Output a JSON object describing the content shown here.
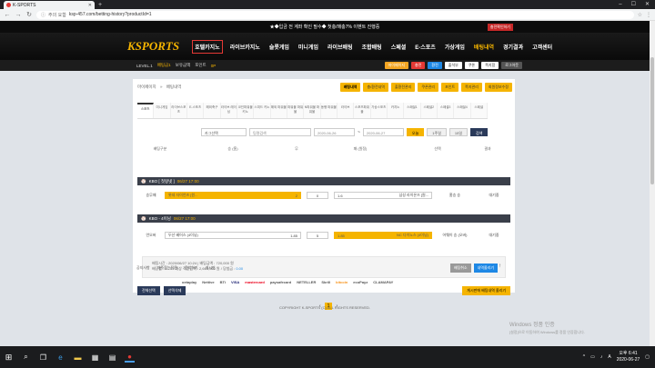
{
  "browser": {
    "tab_title": "K-SPORTS",
    "url_warning": "주의 요함",
    "url": "ksp-457.com/betting-history?productId=1"
  },
  "site": {
    "notice": "★◆입금 전 계좌 확인 필수◆ 첫충/매충7% 이벤트 진행중",
    "notice_badge": "충전확인하기",
    "logo": "SPORTS",
    "logo_badge": "K",
    "nav": [
      "호텔카지노",
      "라이브카지노",
      "슬롯게임",
      "미니게임",
      "라이브배팅",
      "조합배팅",
      "스페셜",
      "E-스포츠",
      "가상게임",
      "배팅내역",
      "경기결과",
      "고객센터"
    ],
    "user": {
      "level": "LEVEL.1",
      "nickname": "배팅금1",
      "balance_label": "보유금액",
      "points_label": "포인트",
      "points_value": "0P",
      "buttons": [
        "마이페이지",
        "충전",
        "환전",
        "출석부",
        "쿠폰",
        "쪽지함",
        "로그아웃"
      ]
    }
  },
  "page": {
    "breadcrumb_home": "마이페이지",
    "breadcrumb_sep": "»",
    "breadcrumb_current": "배팅내역",
    "top_buttons": [
      "배팅내역",
      "충/환전내역",
      "출환전관리",
      "쿠폰관리",
      "포인트",
      "쪽지관리",
      "회원정보수정"
    ],
    "sport_tabs": [
      "스포츠",
      "미니게임",
      "라이브스포츠",
      "E-스포츠",
      "해외축구",
      "라이브 레이싱",
      "코인파워볼 키노",
      "스피드 키노",
      "해외 파워볼",
      "파워볼 파워볼",
      "N파워볼 파워볼",
      "동행 파워볼",
      "라이브",
      "스포츠파워볼",
      "가상스포츠",
      "카지노",
      "스페셜1",
      "스페셜2",
      "스페셜3",
      "스페셜4",
      "스페셜"
    ],
    "filter": {
      "select": "카그선택",
      "search_placeholder": "팀명검색",
      "date_from": "2020-06-26",
      "date_sep": "~",
      "date_to": "2020-06-27",
      "btn_today": "오늘",
      "btn_week": "1주일",
      "btn_15": "15일",
      "btn_search": "검색"
    },
    "columns": [
      "배팅구분",
      "승 (홈)",
      "무",
      "패 (원정)",
      "선택",
      "결과"
    ],
    "games": [
      {
        "league": "KBO [ 첫왕넷 ]",
        "time": "06/27 17:00",
        "type": "승무패",
        "home": "롯데 자이언츠 [원...",
        "home_odds": "2",
        "draw": "0",
        "away": "1.6",
        "away_team": "삼성 라이온즈 [원...",
        "pick": "홈승 승",
        "result": "대기중"
      },
      {
        "league": "KBO - 4이닝",
        "time": "06/27 17:00",
        "type": "언오버",
        "home": "두산 베어스 (4이닝)",
        "home_odds": "1.85",
        "draw": "5",
        "away": "1.85",
        "away_team": "NC 다이노스 (4이닝)",
        "pick": "어웨이 승 (오버)",
        "result": "대기중"
      }
    ],
    "summary_line1": "배팅시간 : 2020/06/27 10:24  |  배팅금액 : 720,000 원",
    "summary_line2": "배당률 : 3.70  /  예상 적중금액 : 2,664,000 원  /  당첨금 : ",
    "summary_win": "0.00",
    "summary_buttons": [
      "배팅취소",
      "내역올리기"
    ],
    "bottom_buttons": [
      "전체선택",
      "선택삭제"
    ],
    "bottom_right_button": "게시판에 배팅내역 올리기",
    "page_prev": "‹",
    "page_current": "1",
    "page_next": "›"
  },
  "footer": {
    "links": [
      "공지사항",
      "자주묻는질문",
      "문의하기",
      "게시판"
    ],
    "logos": [
      "oetaplay",
      "Nettive",
      "BTi",
      "VISA",
      "mastercard",
      "paysafecard",
      "NETELLER",
      "Skrill",
      "bitcoin",
      "ecoPayz",
      "CLAMAPAY"
    ],
    "copyright": "COPYRIGHT K-SPORTS (C) ALL RIGHTS RESERVED."
  },
  "activation": {
    "title": "Windows 정품 인증",
    "subtitle": "[설정]으로 이동하여 Windows를 정품 인증합니다."
  },
  "taskbar": {
    "time": "오후 6:41",
    "date": "2020-06-27"
  }
}
